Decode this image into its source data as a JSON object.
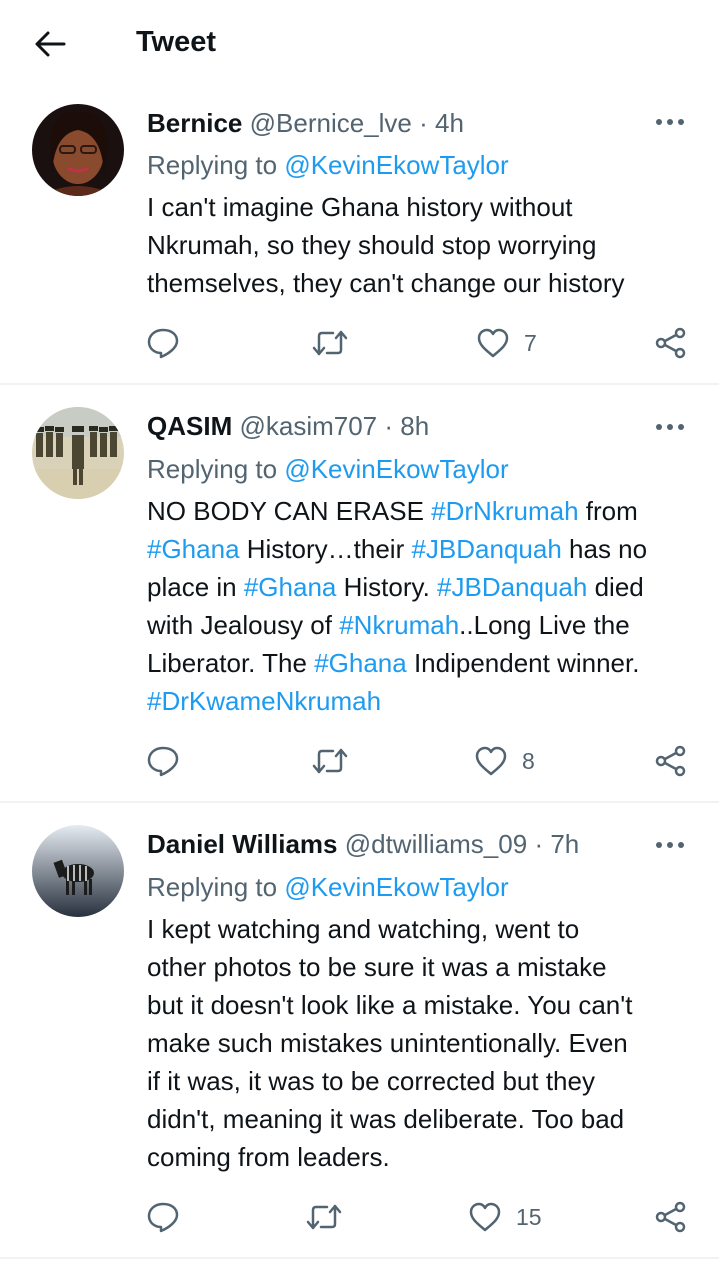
{
  "header": {
    "title": "Tweet"
  },
  "replies": [
    {
      "name": "Bernice",
      "handle": "@Bernice_lve",
      "sep": "·",
      "time": "4h",
      "replying_prefix": "Replying to",
      "replying_to": "@KevinEkowTaylor",
      "body_lines": [
        [
          {
            "t": "I can't imagine Ghana history without"
          }
        ],
        [
          {
            "t": "Nkrumah, so they should stop worrying"
          }
        ],
        [
          {
            "t": "themselves, they can't change our history"
          }
        ]
      ],
      "likes": "7"
    },
    {
      "name": "QASIM",
      "handle": "@kasim707",
      "sep": "·",
      "time": "8h",
      "replying_prefix": "Replying to",
      "replying_to": "@KevinEkowTaylor",
      "body_lines": [
        [
          {
            "t": "NO BODY CAN ERASE "
          },
          {
            "t": "#DrNkrumah",
            "h": true
          },
          {
            "t": " from"
          }
        ],
        [
          {
            "t": "#Ghana",
            "h": true
          },
          {
            "t": " History…their "
          },
          {
            "t": "#JBDanquah",
            "h": true
          },
          {
            "t": " has no"
          }
        ],
        [
          {
            "t": "place in "
          },
          {
            "t": "#Ghana",
            "h": true
          },
          {
            "t": " History. "
          },
          {
            "t": "#JBDanquah",
            "h": true
          },
          {
            "t": " died"
          }
        ],
        [
          {
            "t": "with Jealousy of "
          },
          {
            "t": "#Nkrumah",
            "h": true
          },
          {
            "t": "..Long Live  the"
          }
        ],
        [
          {
            "t": "Liberator. The "
          },
          {
            "t": "#Ghana",
            "h": true
          },
          {
            "t": " Indipendent winner."
          }
        ],
        [
          {
            "t": "#DrKwameNkrumah",
            "h": true
          }
        ]
      ],
      "likes": "8"
    },
    {
      "name": "Daniel Williams",
      "handle": "@dtwilliams_09",
      "sep": "·",
      "time": "7h",
      "replying_prefix": "Replying to",
      "replying_to": "@KevinEkowTaylor",
      "body_lines": [
        [
          {
            "t": "I kept watching and watching, went to"
          }
        ],
        [
          {
            "t": "other photos to be sure it was a mistake"
          }
        ],
        [
          {
            "t": "but it doesn't look like a mistake. You can't"
          }
        ],
        [
          {
            "t": "make such mistakes unintentionally. Even"
          }
        ],
        [
          {
            "t": "if it was, it was to be corrected but they"
          }
        ],
        [
          {
            "t": "didn't, meaning it was deliberate. Too bad"
          }
        ],
        [
          {
            "t": "coming from leaders."
          }
        ]
      ],
      "likes": "15"
    }
  ],
  "icons": {
    "back": "arrow-left-icon",
    "more": "more-dots-icon",
    "reply": "reply-bubble-icon",
    "retweet": "retweet-icon",
    "like": "heart-icon",
    "share": "share-icon"
  },
  "colors": {
    "accent": "#1d9bf0",
    "text": "#0f1419",
    "secondary": "#536471",
    "divider": "#eff3f4"
  }
}
